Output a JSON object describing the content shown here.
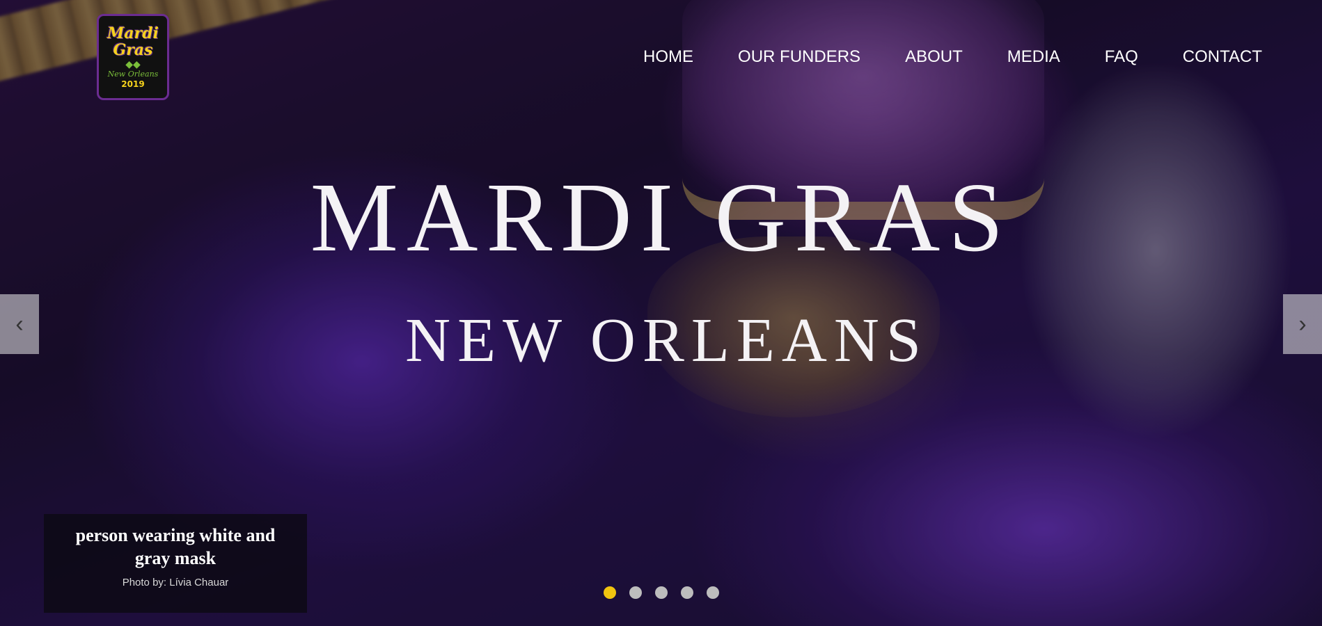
{
  "logo": {
    "line1": "Mardi",
    "line2": "Gras",
    "line3": "New Orleans",
    "year": "2019"
  },
  "nav": {
    "items": [
      "HOME",
      "OUR FUNDERS",
      "ABOUT",
      "MEDIA",
      "FAQ",
      "CONTACT"
    ]
  },
  "hero": {
    "title": "MARDI GRAS",
    "subtitle": "NEW ORLEANS"
  },
  "carousel": {
    "prev_icon": "‹",
    "next_icon": "›",
    "caption_title": "person wearing white and gray mask",
    "caption_credit": "Photo by: Lívia Chauar",
    "slide_count": 5,
    "active_slide": 1,
    "active_color": "#f1c40f",
    "inactive_color": "#bdbdbd"
  }
}
